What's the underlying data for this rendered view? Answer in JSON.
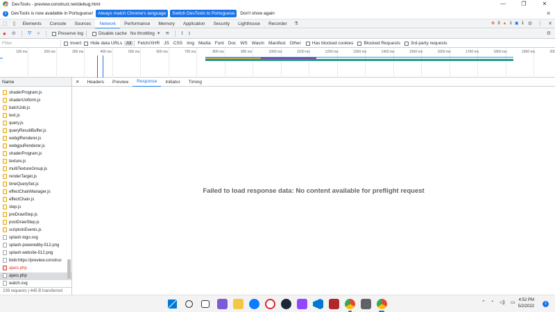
{
  "window": {
    "title": "DevTools - preview.construct.net/debug.html",
    "minimize": "—",
    "maximize": "❐",
    "close": "✕"
  },
  "infobar": {
    "message": "DevTools is now available in Portuguese!",
    "match_button": "Always match Chrome's language",
    "switch_button": "Switch DevTools to Portuguese",
    "dismiss_button": "Don't show again",
    "close": "✕"
  },
  "tabs": [
    "Elements",
    "Console",
    "Sources",
    "Network",
    "Performance",
    "Memory",
    "Application",
    "Security",
    "Lighthouse",
    "Recorder"
  ],
  "active_tab": "Network",
  "badges": {
    "errors": "3",
    "warnings": "1",
    "issues": "1"
  },
  "toolbar": {
    "preserve_log": "Preserve log",
    "disable_cache": "Disable cache",
    "throttling": "No throttling"
  },
  "filter": {
    "placeholder": "Filter",
    "invert": "Invert",
    "hide_data_urls": "Hide data URLs",
    "types": [
      "All",
      "Fetch/XHR",
      "JS",
      "CSS",
      "Img",
      "Media",
      "Font",
      "Doc",
      "WS",
      "Wasm",
      "Manifest",
      "Other"
    ],
    "active_type": "All",
    "has_blocked_cookies": "Has blocked cookies",
    "blocked_requests": "Blocked Requests",
    "third_party": "3rd-party requests"
  },
  "timeline": {
    "ticks": [
      "100 ms",
      "200 ms",
      "300 ms",
      "400 ms",
      "500 ms",
      "600 ms",
      "700 ms",
      "800 ms",
      "900 ms",
      "1000 ms",
      "1100 ms",
      "1200 ms",
      "1300 ms",
      "1400 ms",
      "1500 ms",
      "1600 ms",
      "1700 ms",
      "1800 ms",
      "1900 ms",
      "200"
    ]
  },
  "list": {
    "header": "Name",
    "items": [
      {
        "name": "shaderProgram.js",
        "kind": "js"
      },
      {
        "name": "shaderUniform.js",
        "kind": "js"
      },
      {
        "name": "batchJob.js",
        "kind": "js"
      },
      {
        "name": "text.js",
        "kind": "js"
      },
      {
        "name": "query.js",
        "kind": "js"
      },
      {
        "name": "queryResultBuffer.js",
        "kind": "js"
      },
      {
        "name": "webglRenderer.js",
        "kind": "js"
      },
      {
        "name": "webgpuRenderer.js",
        "kind": "js"
      },
      {
        "name": "shaderProgram.js",
        "kind": "js"
      },
      {
        "name": "texture.js",
        "kind": "js"
      },
      {
        "name": "multiTextureGroup.js",
        "kind": "js"
      },
      {
        "name": "renderTarget.js",
        "kind": "js"
      },
      {
        "name": "timeQuerySet.js",
        "kind": "js"
      },
      {
        "name": "effectChainManager.js",
        "kind": "js"
      },
      {
        "name": "effectChain.js",
        "kind": "js"
      },
      {
        "name": "step.js",
        "kind": "js"
      },
      {
        "name": "preDrawStep.js",
        "kind": "js"
      },
      {
        "name": "postDrawStep.js",
        "kind": "js"
      },
      {
        "name": "scriptsInEvents.js",
        "kind": "js"
      },
      {
        "name": "splash-logo.svg",
        "kind": "img"
      },
      {
        "name": "splash-poweredby-512.png",
        "kind": "img"
      },
      {
        "name": "splash-website-512.png",
        "kind": "img"
      },
      {
        "name": "blob:https://preview.construc",
        "kind": "img"
      },
      {
        "name": "ajaxs.php",
        "kind": "err"
      },
      {
        "name": "ajaxs.php",
        "kind": "sel"
      },
      {
        "name": "watch.svg",
        "kind": "img"
      }
    ],
    "status": "239 requests | 445 B transferred"
  },
  "detail": {
    "close": "✕",
    "tabs": [
      "Headers",
      "Preview",
      "Response",
      "Initiator",
      "Timing"
    ],
    "active_tab": "Response",
    "message": "Failed to load response data: No content available for preflight request"
  },
  "taskbar": {
    "time": "4:52 PM",
    "date": "5/2/2022",
    "notifications": "1"
  }
}
